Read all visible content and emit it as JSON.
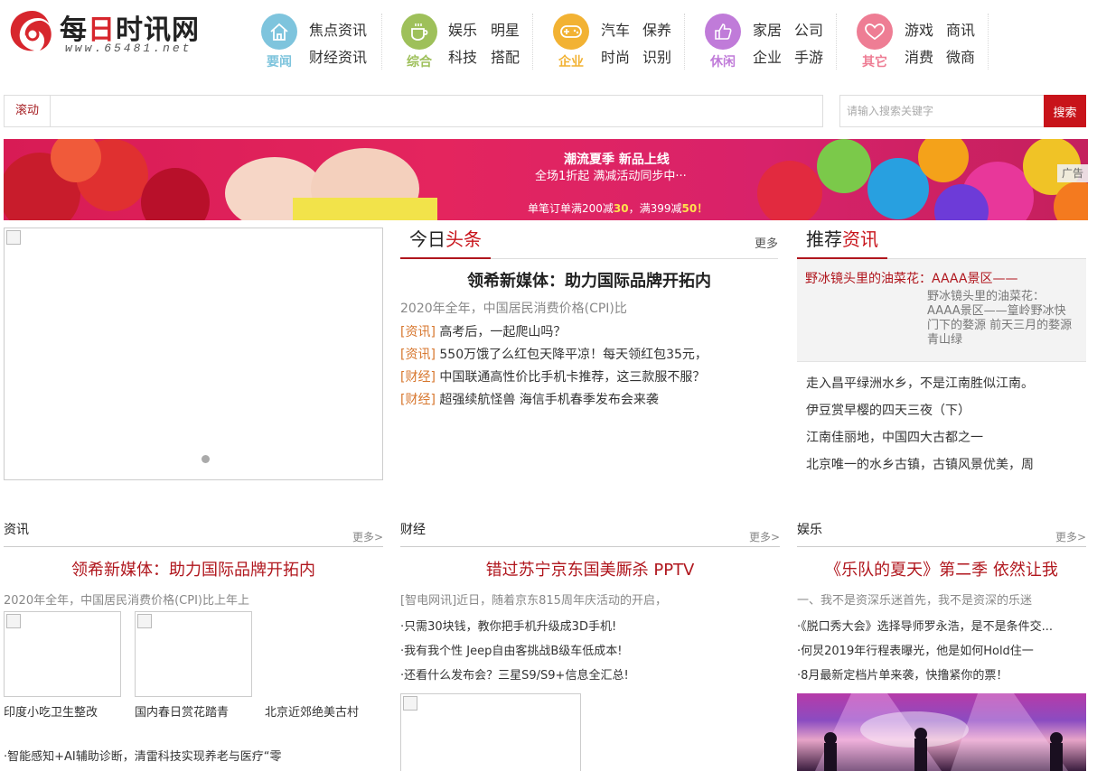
{
  "logo": {
    "name_black": "每",
    "name_mid": "日",
    "name_rest": "时讯网",
    "url": "www.65481.net"
  },
  "nav": [
    {
      "category": "要闻",
      "color": "#7ec4dd",
      "links": [
        "焦点资讯",
        "财经资讯"
      ]
    },
    {
      "category": "综合",
      "color": "#9ec05a",
      "links": [
        "娱乐",
        "明星",
        "科技",
        "搭配"
      ]
    },
    {
      "category": "企业",
      "color": "#f2b233",
      "links": [
        "汽车",
        "保养",
        "时尚",
        "识别"
      ]
    },
    {
      "category": "休闲",
      "color": "#c07bd9",
      "links": [
        "家居",
        "公司",
        "企业",
        "手游"
      ]
    },
    {
      "category": "其它",
      "color": "#ee7d94",
      "links": [
        "游戏",
        "商讯",
        "消费",
        "微商"
      ]
    }
  ],
  "ticker": {
    "label": "滚动"
  },
  "search": {
    "placeholder": "请输入搜索关键字",
    "button": "搜索"
  },
  "banner": {
    "line1": "潮流夏季  新品上线",
    "line2": "全场1折起  满减活动同步中···",
    "line3_a": "单笔订单满200减",
    "line3_b": "30",
    "line3_c": "，满399减",
    "line3_d": "50",
    "line3_e": "！",
    "ad_label": "广告"
  },
  "today": {
    "title_a": "今日",
    "title_b": "头条",
    "more": "更多",
    "headline": "领希新媒体：助力国际品牌开拓内",
    "summary": "2020年全年，中国居民消费价格(CPI)比",
    "items": [
      {
        "tag": "[资讯]",
        "text": "高考后，一起爬山吗？"
      },
      {
        "tag": "[资讯]",
        "text": "550万饿了么红包天降平凉！每天领红包35元，"
      },
      {
        "tag": "[财经]",
        "text": "中国联通高性价比手机卡推荐，这三款服不服？"
      },
      {
        "tag": "[财经]",
        "text": "超强续航怪兽 海信手机春季发布会来袭"
      }
    ]
  },
  "recommend": {
    "title_a": "推荐",
    "title_b": "资讯",
    "top_title": "野冰镜头里的油菜花：AAAA景区——",
    "top_desc": "野冰镜头里的油菜花：AAAA景区——篁岭野冰快门下的婺源 前天三月的婺源青山绿",
    "items": [
      "走入昌平绿洲水乡，不是江南胜似江南。",
      "伊豆赏早樱的四天三夜（下）",
      "江南佳丽地，中国四大古都之一",
      "北京唯一的水乡古镇，古镇风景优美，周"
    ]
  },
  "columns": {
    "news": {
      "title": "资讯",
      "more": "更多>",
      "headline": "领希新媒体：助力国际品牌开拓内",
      "summary": "2020年全年，中国居民消费价格(CPI)比上年上",
      "thumbs": [
        "印度小吃卫生整改",
        "国内春日赏花踏青",
        "北京近郊绝美古村"
      ],
      "bullet": "·智能感知+AI辅助诊断，清雷科技实现养老与医疗“零"
    },
    "finance": {
      "title": "财经",
      "more": "更多>",
      "headline": "错过苏宁京东国美厮杀 PPTV",
      "summary": "[智电网讯]近日，随着京东815周年庆活动的开启，",
      "bullets": [
        "·只需30块钱，教你把手机升级成3D手机!",
        "·我有我个性 Jeep自由客挑战B级车低成本!",
        "·还看什么发布会？三星S9/S9+信息全汇总!"
      ]
    },
    "ent": {
      "title": "娱乐",
      "more": "更多>",
      "headline": "《乐队的夏天》第二季 依然让我",
      "summary": "一、我不是资深乐迷首先，我不是资深的乐迷",
      "bullets": [
        "·《脱口秀大会》选择导师罗永浩，是不是条件交...",
        "·何炅2019年行程表曝光，他是如何Hold住一",
        "·8月最新定档片单来袭，快撸紧你的票！"
      ]
    }
  }
}
